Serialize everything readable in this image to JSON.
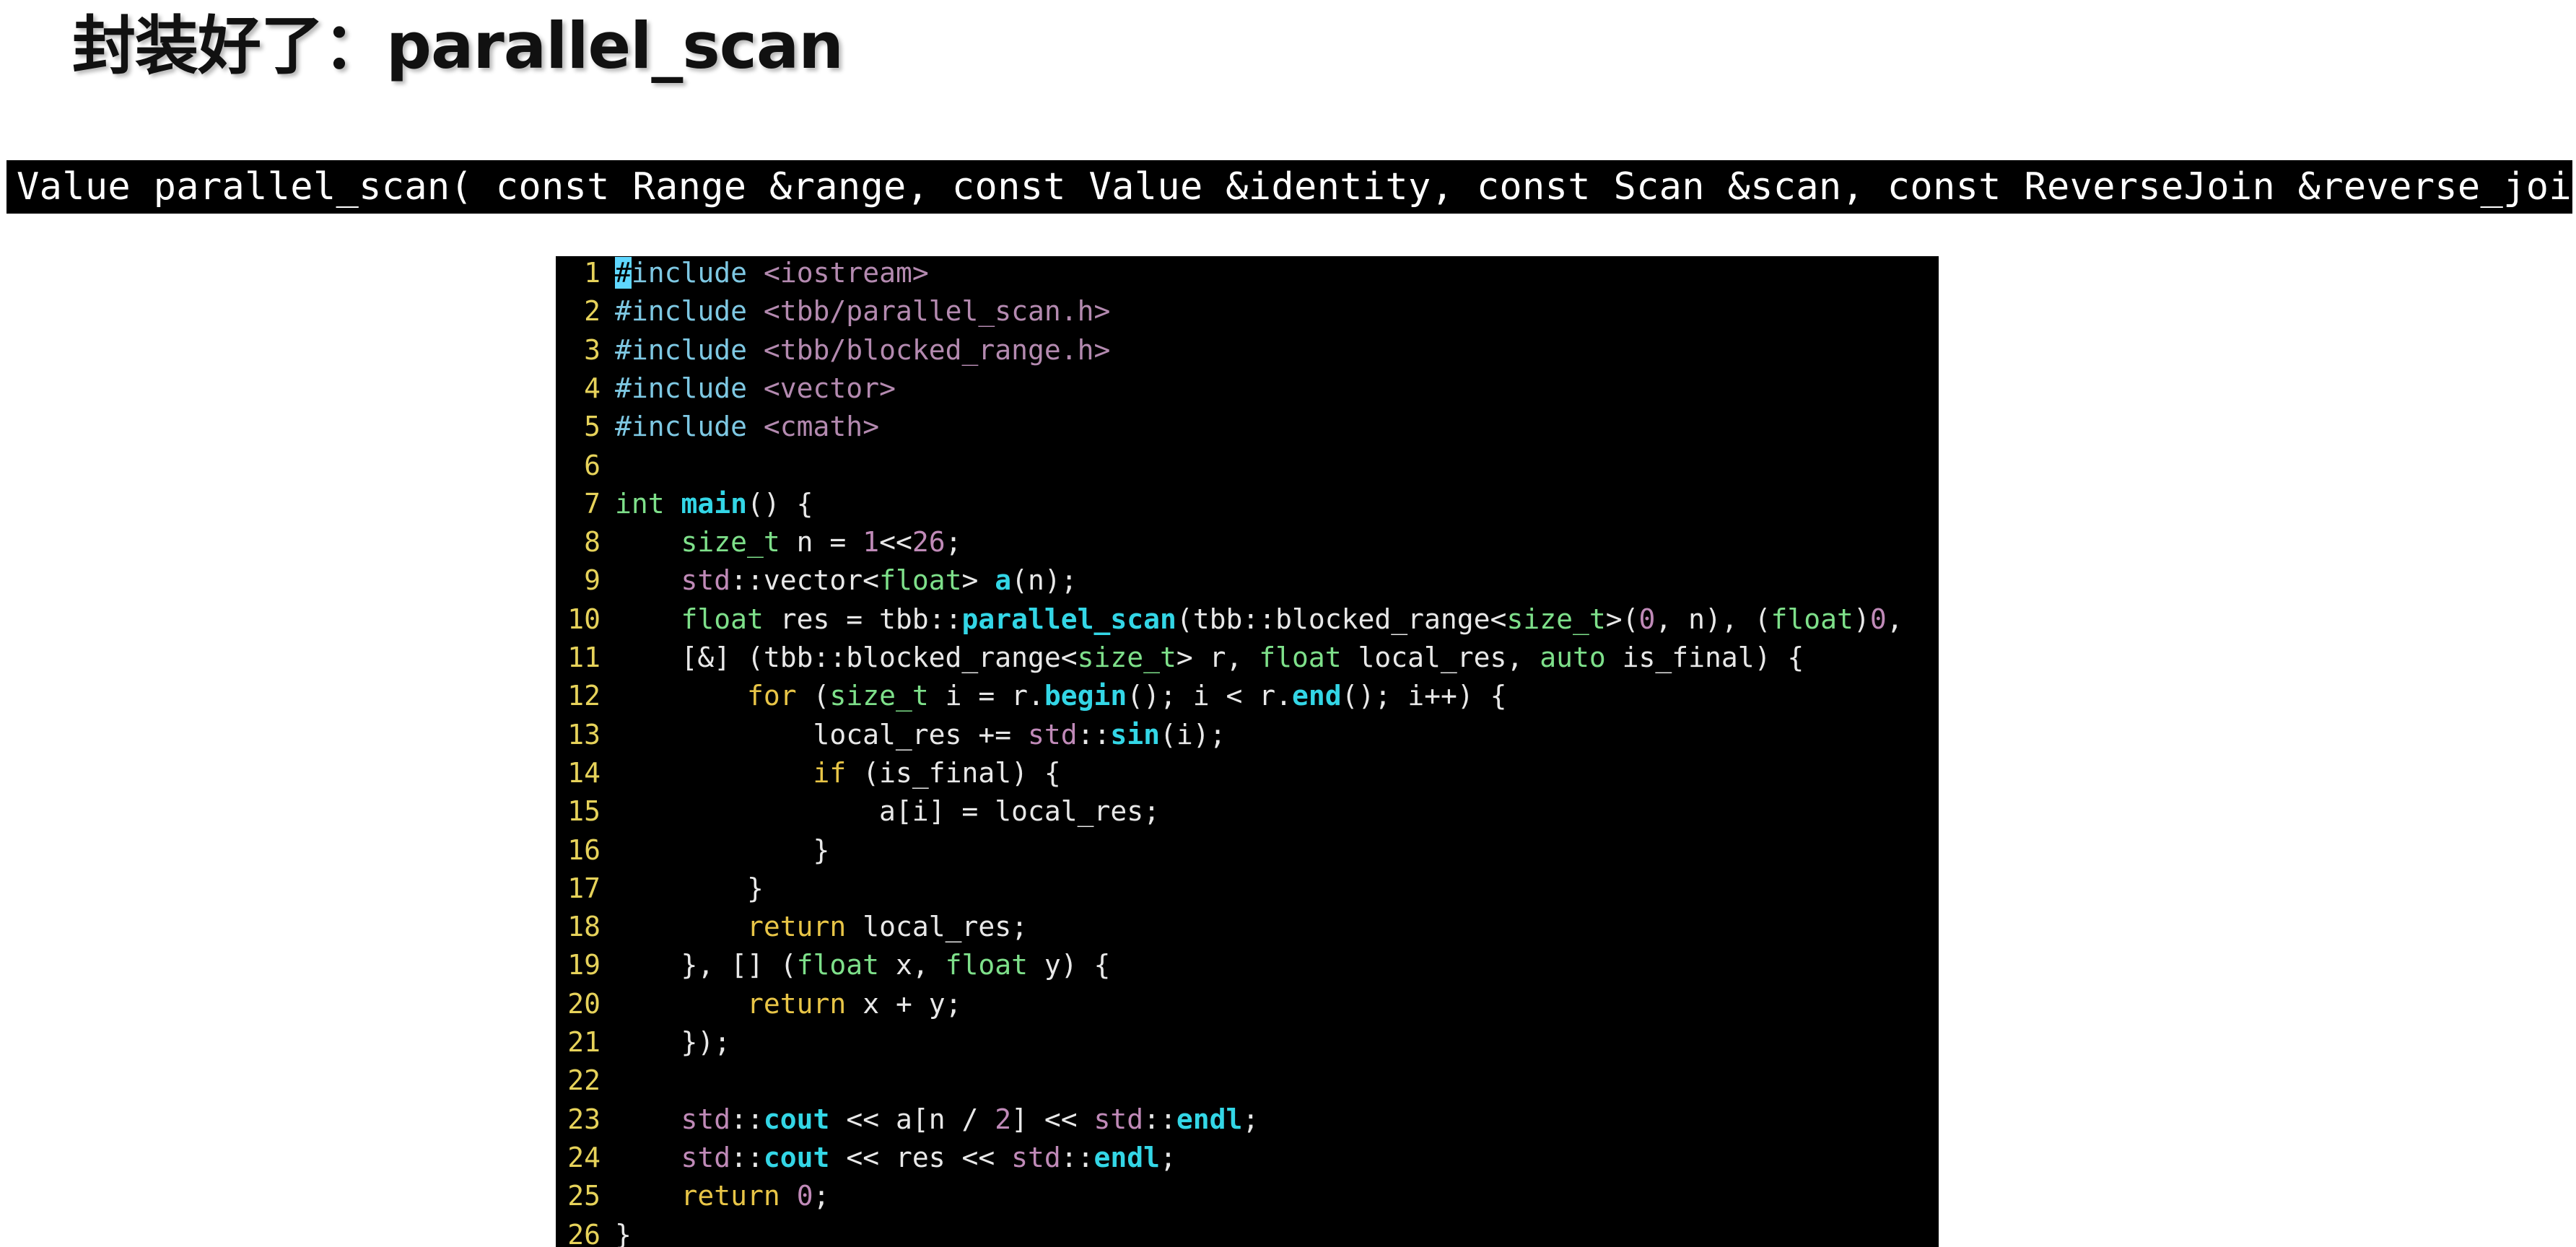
{
  "slide": {
    "title": "封装好了：parallel_scan",
    "signature": "Value parallel_scan( const Range &range, const Value &identity, const Scan &scan, const ReverseJoin &reverse_join )"
  },
  "colors": {
    "text": "#e8e8e8",
    "line_number": "#e6d25a",
    "directive": "#7ec8e3",
    "include_path": "#b48ab0",
    "keyword": "#7ee08a",
    "control": "#e8c547",
    "function_bold": "#33d6e6",
    "namespace": "#c08ab8",
    "number": "#c08ab8",
    "cursor_bg": "#5fd7ff"
  },
  "editor": {
    "lines": [
      {
        "n": "1",
        "tokens": [
          {
            "t": "#",
            "c": "cursor"
          },
          {
            "t": "include",
            "c": "directive"
          },
          {
            "t": " ",
            "c": "text"
          },
          {
            "t": "<iostream>",
            "c": "include_path"
          }
        ]
      },
      {
        "n": "2",
        "tokens": [
          {
            "t": "#include",
            "c": "directive"
          },
          {
            "t": " ",
            "c": "text"
          },
          {
            "t": "<tbb/parallel_scan.h>",
            "c": "include_path"
          }
        ]
      },
      {
        "n": "3",
        "tokens": [
          {
            "t": "#include",
            "c": "directive"
          },
          {
            "t": " ",
            "c": "text"
          },
          {
            "t": "<tbb/blocked_range.h>",
            "c": "include_path"
          }
        ]
      },
      {
        "n": "4",
        "tokens": [
          {
            "t": "#include",
            "c": "directive"
          },
          {
            "t": " ",
            "c": "text"
          },
          {
            "t": "<vector>",
            "c": "include_path"
          }
        ]
      },
      {
        "n": "5",
        "tokens": [
          {
            "t": "#include",
            "c": "directive"
          },
          {
            "t": " ",
            "c": "text"
          },
          {
            "t": "<cmath>",
            "c": "include_path"
          }
        ]
      },
      {
        "n": "6",
        "tokens": []
      },
      {
        "n": "7",
        "tokens": [
          {
            "t": "int",
            "c": "keyword"
          },
          {
            "t": " ",
            "c": "text"
          },
          {
            "t": "main",
            "c": "function_bold"
          },
          {
            "t": "() {",
            "c": "text"
          }
        ]
      },
      {
        "n": "8",
        "tokens": [
          {
            "t": "    ",
            "c": "text"
          },
          {
            "t": "size_t",
            "c": "keyword"
          },
          {
            "t": " n = ",
            "c": "text"
          },
          {
            "t": "1",
            "c": "number"
          },
          {
            "t": "<<",
            "c": "text"
          },
          {
            "t": "26",
            "c": "number"
          },
          {
            "t": ";",
            "c": "text"
          }
        ]
      },
      {
        "n": "9",
        "tokens": [
          {
            "t": "    ",
            "c": "text"
          },
          {
            "t": "std",
            "c": "namespace"
          },
          {
            "t": "::vector<",
            "c": "text"
          },
          {
            "t": "float",
            "c": "keyword"
          },
          {
            "t": "> ",
            "c": "text"
          },
          {
            "t": "a",
            "c": "function_bold"
          },
          {
            "t": "(n);",
            "c": "text"
          }
        ]
      },
      {
        "n": "10",
        "tokens": [
          {
            "t": "    ",
            "c": "text"
          },
          {
            "t": "float",
            "c": "keyword"
          },
          {
            "t": " res = tbb::",
            "c": "text"
          },
          {
            "t": "parallel_scan",
            "c": "function_bold"
          },
          {
            "t": "(tbb::blocked_range<",
            "c": "text"
          },
          {
            "t": "size_t",
            "c": "keyword"
          },
          {
            "t": ">(",
            "c": "text"
          },
          {
            "t": "0",
            "c": "number"
          },
          {
            "t": ", n), (",
            "c": "text"
          },
          {
            "t": "float",
            "c": "keyword"
          },
          {
            "t": ")",
            "c": "text"
          },
          {
            "t": "0",
            "c": "number"
          },
          {
            "t": ",",
            "c": "text"
          }
        ]
      },
      {
        "n": "11",
        "tokens": [
          {
            "t": "    [&] (tbb::blocked_range<",
            "c": "text"
          },
          {
            "t": "size_t",
            "c": "keyword"
          },
          {
            "t": "> r, ",
            "c": "text"
          },
          {
            "t": "float",
            "c": "keyword"
          },
          {
            "t": " local_res, ",
            "c": "text"
          },
          {
            "t": "auto",
            "c": "keyword"
          },
          {
            "t": " is_final) {",
            "c": "text"
          }
        ]
      },
      {
        "n": "12",
        "tokens": [
          {
            "t": "        ",
            "c": "text"
          },
          {
            "t": "for",
            "c": "control"
          },
          {
            "t": " (",
            "c": "text"
          },
          {
            "t": "size_t",
            "c": "keyword"
          },
          {
            "t": " i = r.",
            "c": "text"
          },
          {
            "t": "begin",
            "c": "function_bold"
          },
          {
            "t": "(); i < r.",
            "c": "text"
          },
          {
            "t": "end",
            "c": "function_bold"
          },
          {
            "t": "(); i++) {",
            "c": "text"
          }
        ]
      },
      {
        "n": "13",
        "tokens": [
          {
            "t": "            local_res += ",
            "c": "text"
          },
          {
            "t": "std",
            "c": "namespace"
          },
          {
            "t": "::",
            "c": "text"
          },
          {
            "t": "sin",
            "c": "function_bold"
          },
          {
            "t": "(i);",
            "c": "text"
          }
        ]
      },
      {
        "n": "14",
        "tokens": [
          {
            "t": "            ",
            "c": "text"
          },
          {
            "t": "if",
            "c": "control"
          },
          {
            "t": " (is_final) {",
            "c": "text"
          }
        ]
      },
      {
        "n": "15",
        "tokens": [
          {
            "t": "                a[i] = local_res;",
            "c": "text"
          }
        ]
      },
      {
        "n": "16",
        "tokens": [
          {
            "t": "            }",
            "c": "text"
          }
        ]
      },
      {
        "n": "17",
        "tokens": [
          {
            "t": "        }",
            "c": "text"
          }
        ]
      },
      {
        "n": "18",
        "tokens": [
          {
            "t": "        ",
            "c": "text"
          },
          {
            "t": "return",
            "c": "control"
          },
          {
            "t": " local_res;",
            "c": "text"
          }
        ]
      },
      {
        "n": "19",
        "tokens": [
          {
            "t": "    }, [] (",
            "c": "text"
          },
          {
            "t": "float",
            "c": "keyword"
          },
          {
            "t": " x, ",
            "c": "text"
          },
          {
            "t": "float",
            "c": "keyword"
          },
          {
            "t": " y) {",
            "c": "text"
          }
        ]
      },
      {
        "n": "20",
        "tokens": [
          {
            "t": "        ",
            "c": "text"
          },
          {
            "t": "return",
            "c": "control"
          },
          {
            "t": " x + y;",
            "c": "text"
          }
        ]
      },
      {
        "n": "21",
        "tokens": [
          {
            "t": "    });",
            "c": "text"
          }
        ]
      },
      {
        "n": "22",
        "tokens": []
      },
      {
        "n": "23",
        "tokens": [
          {
            "t": "    ",
            "c": "text"
          },
          {
            "t": "std",
            "c": "namespace"
          },
          {
            "t": "::",
            "c": "text"
          },
          {
            "t": "cout",
            "c": "function_bold"
          },
          {
            "t": " << a[n / ",
            "c": "text"
          },
          {
            "t": "2",
            "c": "number"
          },
          {
            "t": "] << ",
            "c": "text"
          },
          {
            "t": "std",
            "c": "namespace"
          },
          {
            "t": "::",
            "c": "text"
          },
          {
            "t": "endl",
            "c": "function_bold"
          },
          {
            "t": ";",
            "c": "text"
          }
        ]
      },
      {
        "n": "24",
        "tokens": [
          {
            "t": "    ",
            "c": "text"
          },
          {
            "t": "std",
            "c": "namespace"
          },
          {
            "t": "::",
            "c": "text"
          },
          {
            "t": "cout",
            "c": "function_bold"
          },
          {
            "t": " << res << ",
            "c": "text"
          },
          {
            "t": "std",
            "c": "namespace"
          },
          {
            "t": "::",
            "c": "text"
          },
          {
            "t": "endl",
            "c": "function_bold"
          },
          {
            "t": ";",
            "c": "text"
          }
        ]
      },
      {
        "n": "25",
        "tokens": [
          {
            "t": "    ",
            "c": "text"
          },
          {
            "t": "return",
            "c": "control"
          },
          {
            "t": " ",
            "c": "text"
          },
          {
            "t": "0",
            "c": "number"
          },
          {
            "t": ";",
            "c": "text"
          }
        ]
      },
      {
        "n": "26",
        "tokens": [
          {
            "t": "}",
            "c": "text"
          }
        ]
      }
    ]
  }
}
